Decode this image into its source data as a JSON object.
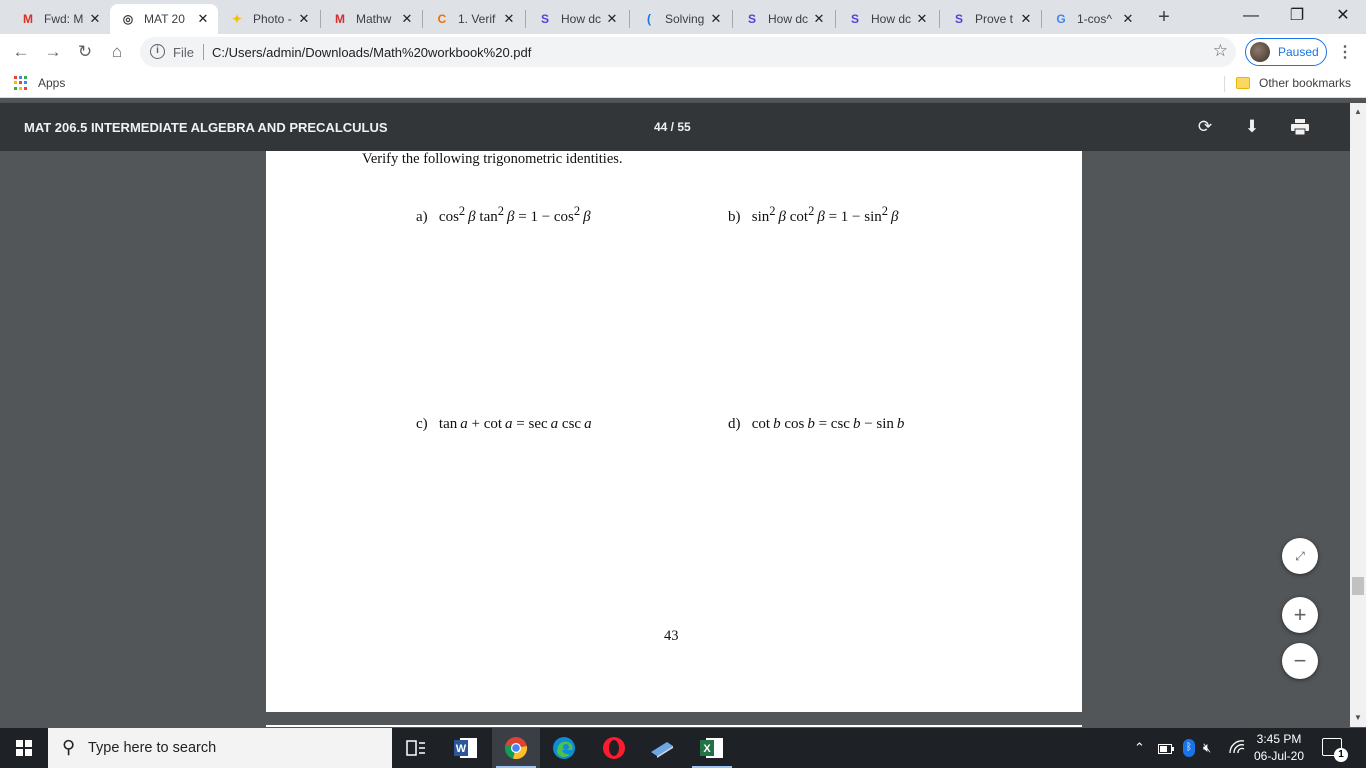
{
  "browser": {
    "tabs": [
      {
        "label": "Fwd: M",
        "favicon": "M",
        "icon": "gmail-icon",
        "color": "#d93025"
      },
      {
        "label": "MAT 20",
        "favicon": "◎",
        "icon": "globe-icon",
        "color": "#3c4043",
        "active": true
      },
      {
        "label": "Photo -",
        "favicon": "✦",
        "icon": "google-photos-icon",
        "color": "#fbbc04"
      },
      {
        "label": "Mathw",
        "favicon": "M",
        "icon": "mathway-icon",
        "color": "#d32f2f"
      },
      {
        "label": "1. Verif",
        "favicon": "C",
        "icon": "chegg-icon",
        "color": "#eb7100"
      },
      {
        "label": "How dc",
        "favicon": "S",
        "icon": "socratic-icon",
        "color": "#5a3fd6"
      },
      {
        "label": "Solving",
        "favicon": "(",
        "icon": "bracket-icon",
        "color": "#1a73e8"
      },
      {
        "label": "How dc",
        "favicon": "S",
        "icon": "socratic-icon",
        "color": "#5a3fd6"
      },
      {
        "label": "How dc",
        "favicon": "S",
        "icon": "socratic-icon",
        "color": "#5a3fd6"
      },
      {
        "label": "Prove t",
        "favicon": "S",
        "icon": "socratic-icon",
        "color": "#5a3fd6"
      },
      {
        "label": "1-cos^",
        "favicon": "G",
        "icon": "google-icon",
        "color": "#4285f4"
      }
    ],
    "close_glyph": "✕",
    "new_tab": "+",
    "window_controls": {
      "minimize": "—",
      "restore": "❐",
      "close": "✕"
    },
    "omnibox": {
      "scheme": "File",
      "url": "C:/Users/admin/Downloads/Math%20workbook%20.pdf"
    },
    "profile_status": "Paused",
    "bookmarks": {
      "apps": "Apps",
      "other": "Other bookmarks"
    }
  },
  "pdf_viewer": {
    "title": "MAT 206.5 INTERMEDIATE ALGEBRA AND PRECALCULUS",
    "page_indicator": "44 / 55"
  },
  "document": {
    "instruction": "Verify the following trigonometric identities.",
    "problems": [
      {
        "label": "a)",
        "html": "cos<sup>2</sup>&thinsp;<i>β</i> tan<sup>2</sup>&thinsp;<i>β</i> = 1 − cos<sup>2</sup>&thinsp;<i>β</i>"
      },
      {
        "label": "b)",
        "html": "sin<sup>2</sup>&thinsp;<i>β</i> cot<sup>2</sup>&thinsp;<i>β</i> = 1 − sin<sup>2</sup>&thinsp;<i>β</i>"
      },
      {
        "label": "c)",
        "html": "tan&thinsp;<i>a</i> + cot&thinsp;<i>a</i> = sec&thinsp;<i>a</i> csc&thinsp;<i>a</i>"
      },
      {
        "label": "d)",
        "html": "cot&thinsp;<i>b</i> cos&thinsp;<i>b</i> = csc&thinsp;<i>b</i> − sin&thinsp;<i>b</i>"
      }
    ],
    "page_number": "43"
  },
  "zoom_controls": {
    "fit": "⤢",
    "zoom_in": "+",
    "zoom_out": "−"
  },
  "taskbar": {
    "search_placeholder": "Type here to search",
    "time": "3:45 PM",
    "date": "06-Jul-20",
    "notification_count": "1"
  }
}
